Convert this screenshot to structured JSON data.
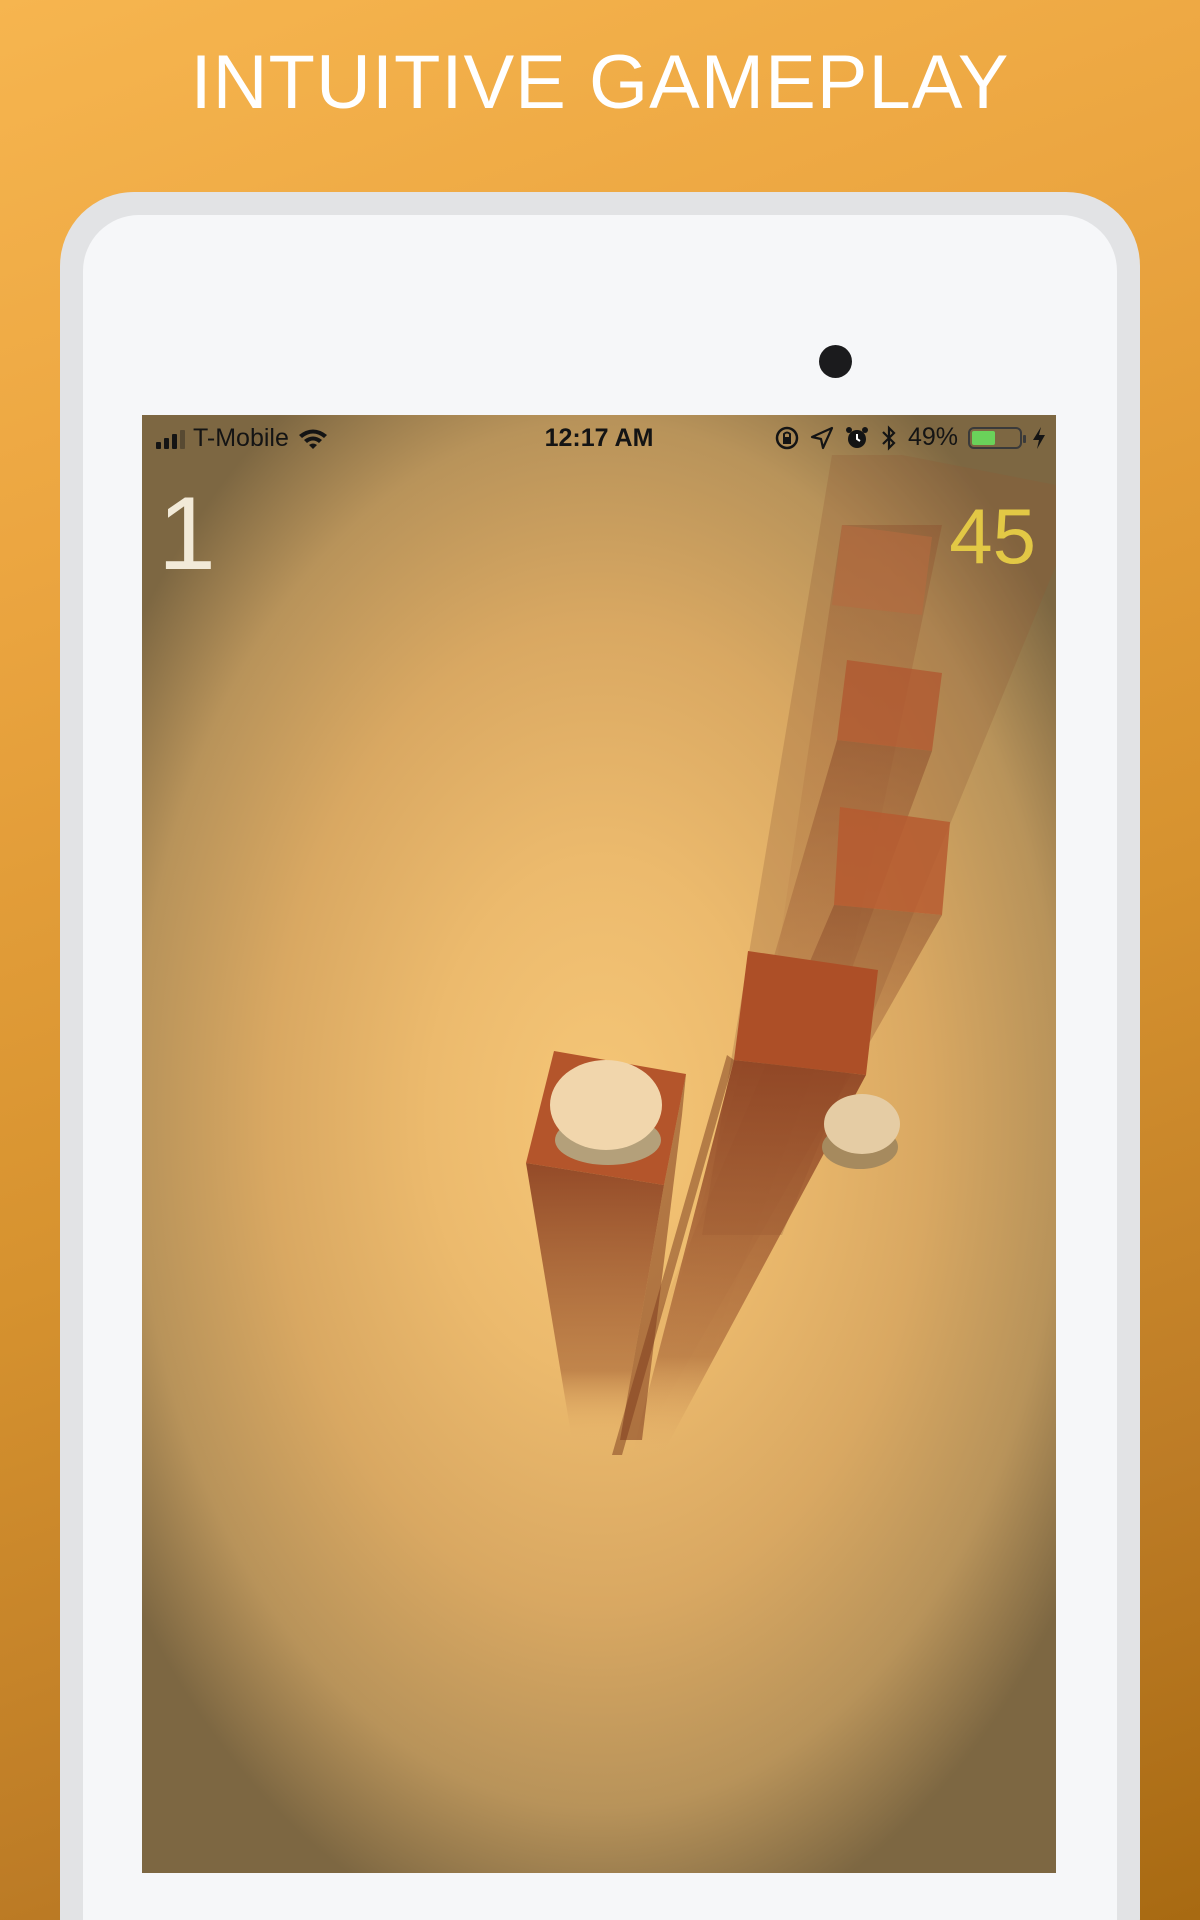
{
  "header": {
    "title": "INTUITIVE GAMEPLAY"
  },
  "statusbar": {
    "carrier": "T-Mobile",
    "time": "12:17 AM",
    "battery_percent": "49%",
    "battery_level": 0.49,
    "icons": [
      "signal-icon",
      "wifi-icon",
      "rotation-lock-icon",
      "location-icon",
      "alarm-icon",
      "bluetooth-icon",
      "battery-icon",
      "charging-icon"
    ]
  },
  "game": {
    "level": "1",
    "score": "45"
  },
  "colors": {
    "background_top": "#f6b54f",
    "background_bottom": "#a86a12",
    "pillar": "#b4552b",
    "ball": "#f1d6ac",
    "score": "#e2c845"
  }
}
